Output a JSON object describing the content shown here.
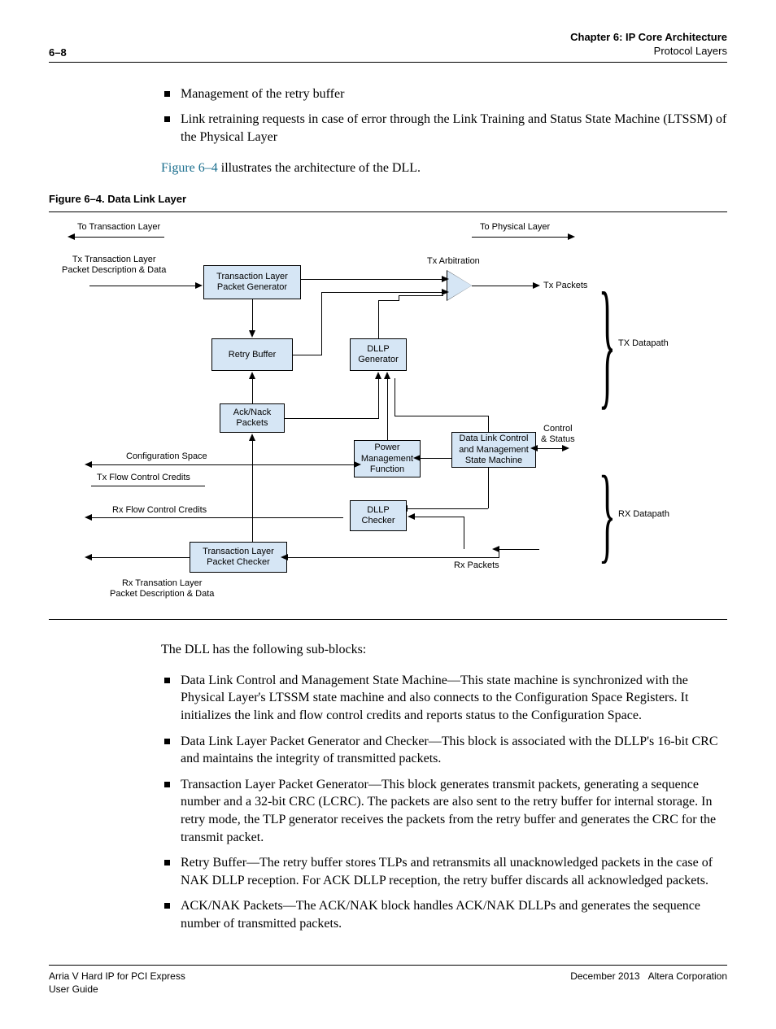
{
  "header": {
    "pageno": "6–8",
    "chapter": "Chapter 6: IP Core Architecture",
    "section": "Protocol Layers"
  },
  "top_bullets": [
    "Management of the retry buffer",
    "Link retraining requests in case of error through the Link Training and Status State Machine (LTSSM) of the Physical Layer"
  ],
  "fig_ref_sentence": {
    "link": "Figure 6–4",
    "rest": " illustrates the architecture of the DLL."
  },
  "figure": {
    "caption": "Figure 6–4. Data Link Layer",
    "labels": {
      "to_transaction": "To Transaction Layer",
      "to_physical": "To Physical Layer",
      "tx_tlp_desc": "Tx Transaction Layer\nPacket Description & Data",
      "tx_arbitration": "Tx Arbitration",
      "tx_packets": "Tx Packets",
      "tx_datapath": "TX Datapath",
      "config_space": "Configuration Space",
      "tx_flow": "Tx Flow Control Credits",
      "rx_flow": "Rx Flow Control Credits",
      "control_status": "Control\n& Status",
      "rx_datapath": "RX Datapath",
      "rx_packets": "Rx Packets",
      "rx_tlp_desc": "Rx Transation Layer\nPacket Description & Data"
    },
    "boxes": {
      "tlp_gen": "Transaction Layer\nPacket Generator",
      "retry_buffer": "Retry Buffer",
      "dllp_gen": "DLLP\nGenerator",
      "ack_nack": "Ack/Nack\nPackets",
      "power_mgmt": "Power\nManagement\nFunction",
      "dlcm": "Data Link Control\nand Management\nState Machine",
      "dllp_checker": "DLLP\nChecker",
      "tlp_checker": "Transaction Layer\nPacket Checker"
    }
  },
  "mid_para": "The DLL has the following sub-blocks:",
  "sub_bullets": [
    "Data Link Control and Management State Machine—This state machine is synchronized with the Physical Layer's LTSSM state machine and also connects to the Configuration Space Registers. It initializes the link and flow control credits and reports status to the Configuration Space.",
    "Data Link Layer Packet Generator and Checker—This block is associated with the DLLP's 16-bit CRC and maintains the integrity of transmitted packets.",
    "Transaction Layer Packet Generator—This block generates transmit packets, generating a sequence number and a 32-bit CRC (LCRC). The packets are also sent to the retry buffer for internal storage. In retry mode, the TLP generator receives the packets from the retry buffer and generates the CRC for the transmit packet.",
    "Retry Buffer—The retry buffer stores TLPs and retransmits all unacknowledged packets in the case of NAK DLLP reception. For ACK DLLP reception, the retry buffer discards all acknowledged packets.",
    "ACK/NAK Packets—The ACK/NAK block handles ACK/NAK DLLPs and generates the sequence number of transmitted packets."
  ],
  "footer": {
    "left1": "Arria V Hard IP for PCI Express",
    "left2": "User Guide",
    "right": "December 2013   Altera Corporation"
  }
}
